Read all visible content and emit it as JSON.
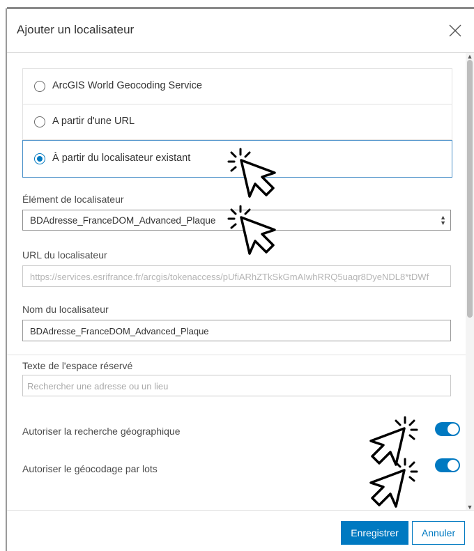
{
  "dialog": {
    "title": "Ajouter un localisateur"
  },
  "radio_options": [
    {
      "label": "ArcGIS World Geocoding Service",
      "selected": false
    },
    {
      "label": "A partir d'une URL",
      "selected": false
    },
    {
      "label": "À partir du localisateur existant",
      "selected": true
    }
  ],
  "locator_element": {
    "label": "Élément de localisateur",
    "value": "BDAdresse_FranceDOM_Advanced_Plaque"
  },
  "locator_url": {
    "label": "URL du localisateur",
    "value": "https://services.esrifrance.fr/arcgis/tokenaccess/pUfiARhZTkSkGmAIwhRRQ5uaqr8DyeNDL8*tDWf"
  },
  "locator_name": {
    "label": "Nom du localisateur",
    "value": "BDAdresse_FranceDOM_Advanced_Plaque"
  },
  "placeholder_text": {
    "label": "Texte de l'espace réservé",
    "placeholder": "Rechercher une adresse ou un lieu"
  },
  "toggles": [
    {
      "label": "Autoriser la recherche géographique",
      "on": true
    },
    {
      "label": "Autoriser le géocodage par lots",
      "on": true
    }
  ],
  "footer": {
    "save_label": "Enregistrer",
    "cancel_label": "Annuler"
  },
  "colors": {
    "accent": "#0079c1",
    "selected_border": "#4a90c8"
  },
  "icons": {
    "close": "close-icon",
    "select_arrows": "chevron-updown-icon",
    "annotation": "click-cursor-icon"
  }
}
